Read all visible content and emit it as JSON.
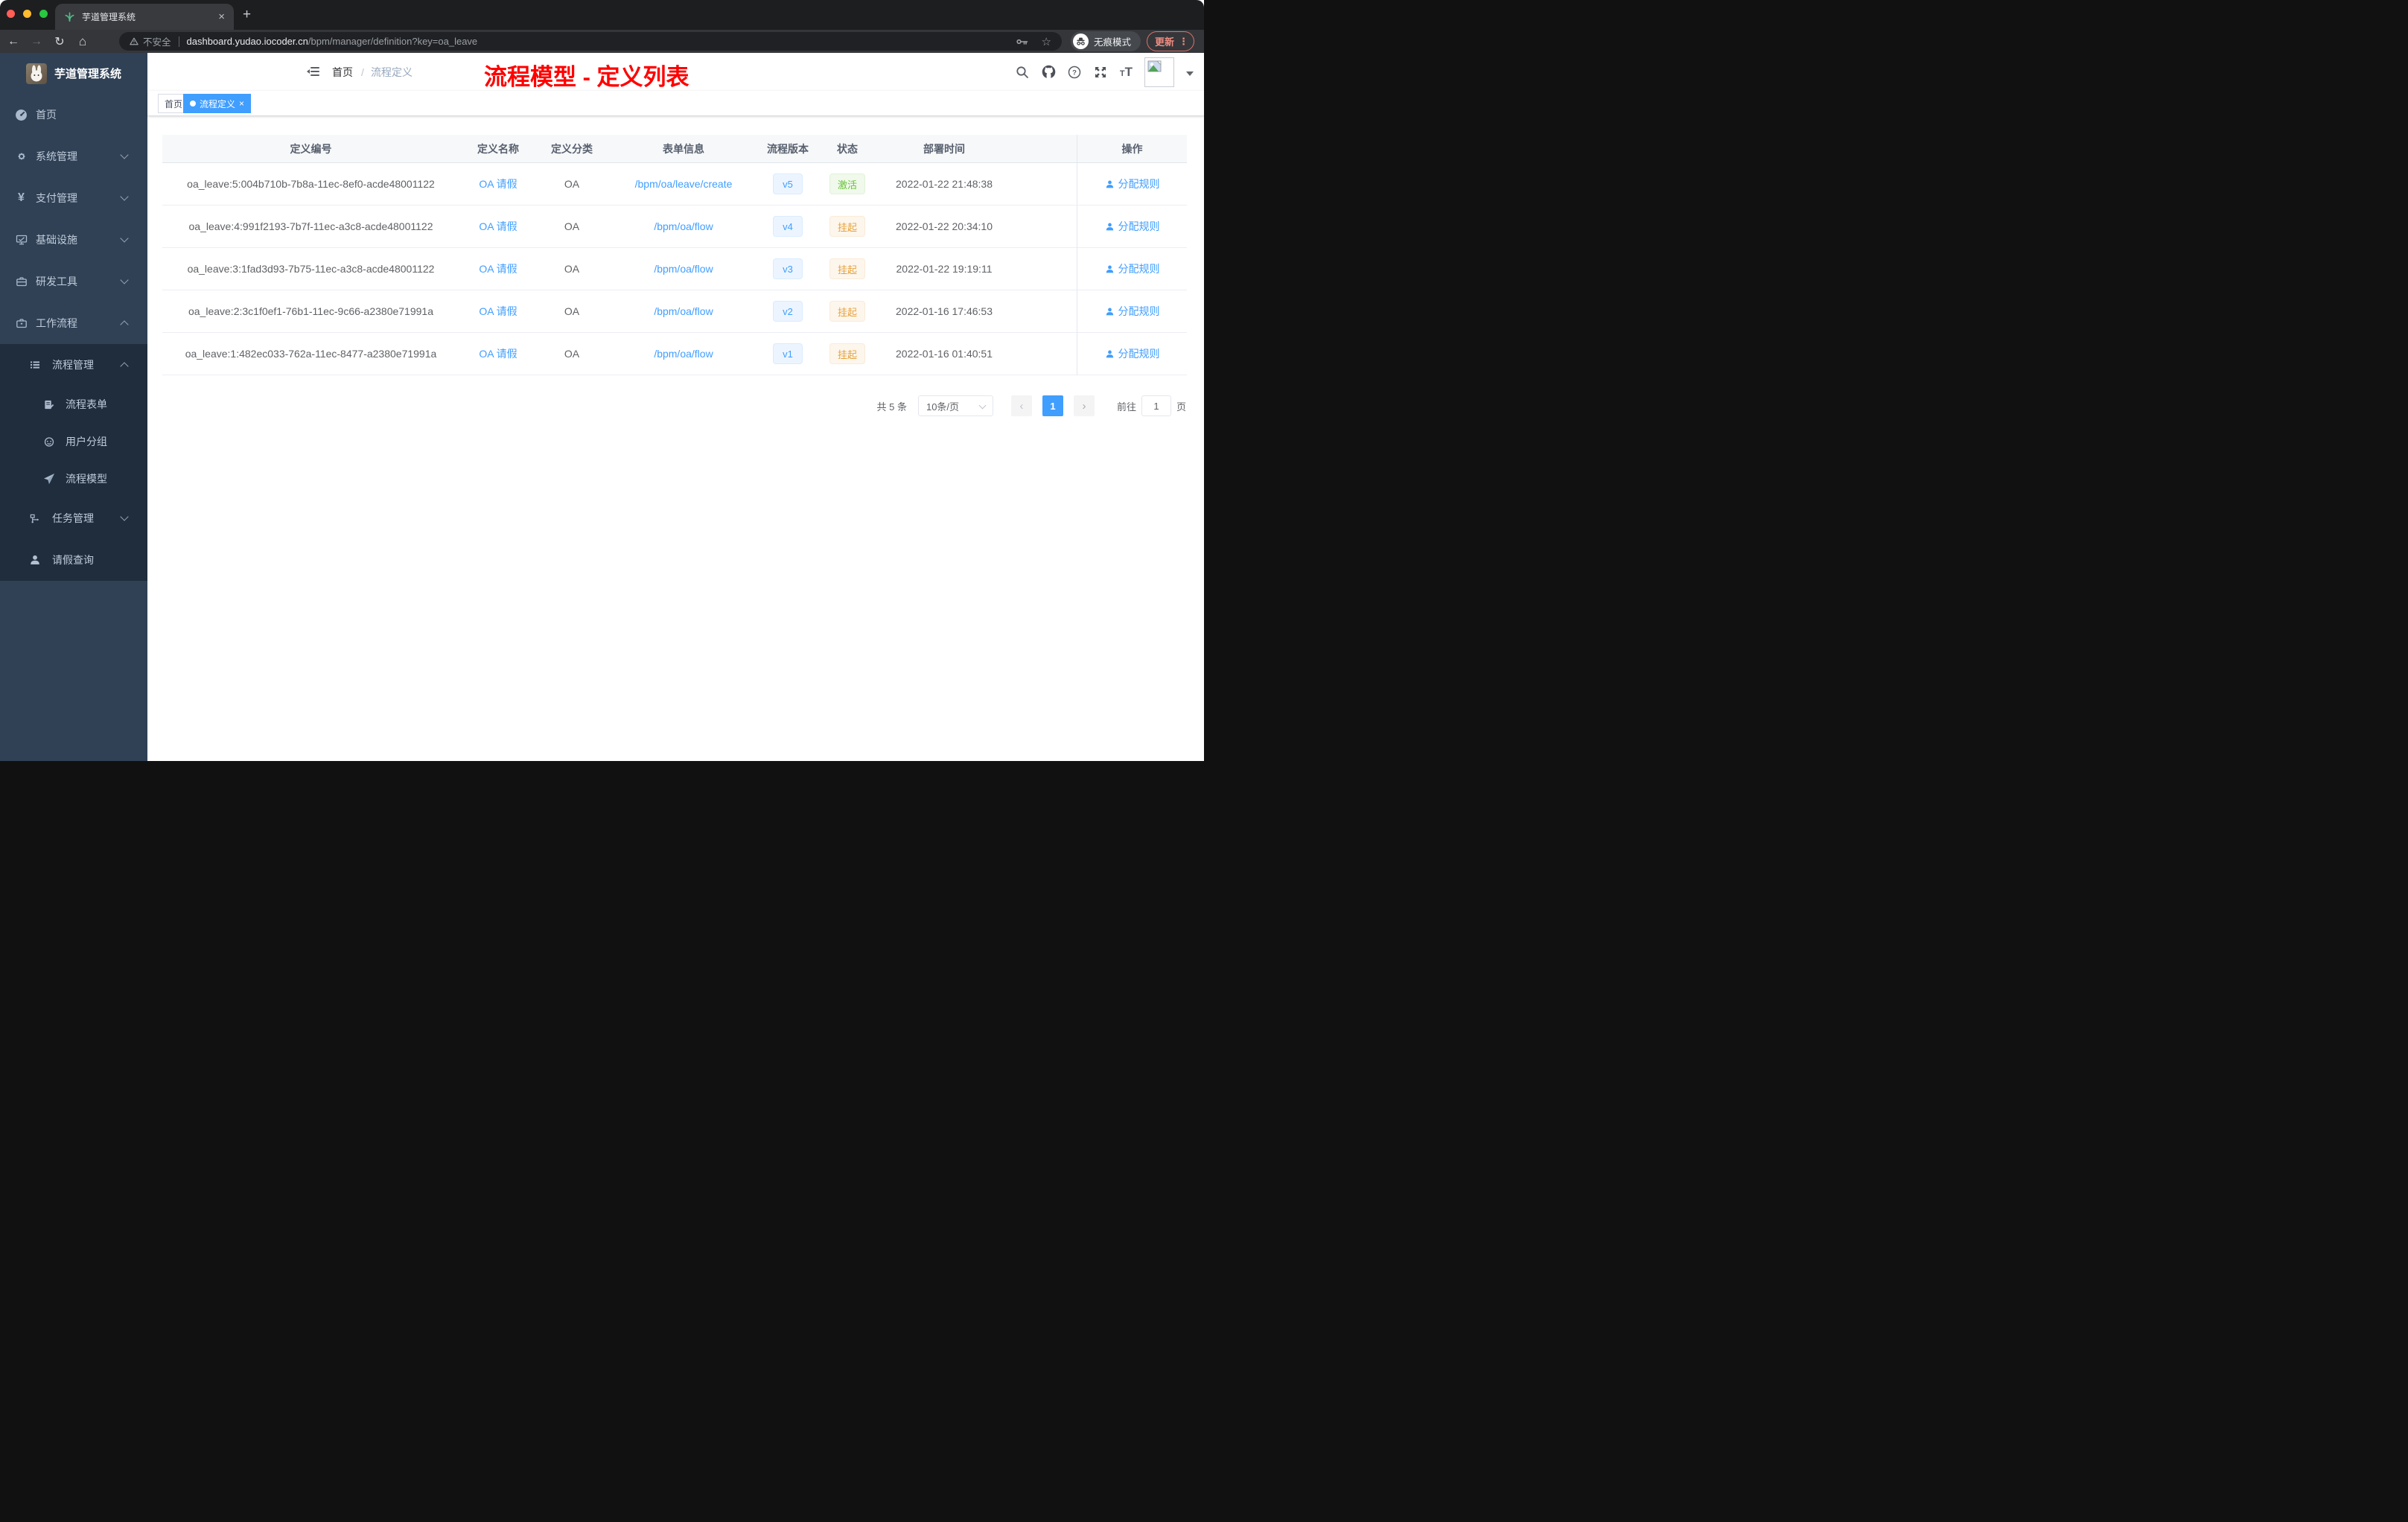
{
  "browser": {
    "tab_title": "芋道管理系统",
    "close_tab_glyph": "×",
    "new_tab_glyph": "+",
    "security_label": "不安全",
    "url_host": "dashboard.yudao.iocoder.cn",
    "url_path": "/bpm/manager/definition?key=oa_leave",
    "star_glyph": "☆",
    "incognito_label": "无痕模式",
    "update_label": "更新",
    "menu_dots": "⋮"
  },
  "sidebar": {
    "app_title": "芋道管理系统",
    "items": [
      {
        "label": "首页",
        "icon": "dashboard-icon"
      },
      {
        "label": "系统管理",
        "icon": "gear-icon",
        "chevron": "down"
      },
      {
        "label": "支付管理",
        "icon": "yen-icon",
        "chevron": "down"
      },
      {
        "label": "基础设施",
        "icon": "monitor-icon",
        "chevron": "down"
      },
      {
        "label": "研发工具",
        "icon": "toolbox-icon",
        "chevron": "down"
      },
      {
        "label": "工作流程",
        "icon": "briefcase-icon",
        "chevron": "up"
      }
    ],
    "yen_glyph": "¥",
    "workflow": {
      "process_mgmt": {
        "label": "流程管理",
        "icon": "list-icon",
        "chevron": "up"
      },
      "process_children": [
        {
          "label": "流程表单",
          "icon": "form-icon"
        },
        {
          "label": "用户分组",
          "icon": "user-group-icon"
        },
        {
          "label": "流程模型",
          "icon": "paper-plane-icon"
        }
      ],
      "task_mgmt": {
        "label": "任务管理",
        "icon": "tree-icon",
        "chevron": "down"
      },
      "leave_query": {
        "label": "请假查询",
        "icon": "person-icon"
      }
    }
  },
  "header": {
    "breadcrumb_home": "首页",
    "breadcrumb_sep": "/",
    "breadcrumb_current": "流程定义",
    "annotation": "流程模型 - 定义列表"
  },
  "tags": {
    "home": "首页",
    "active": "流程定义",
    "close_glyph": "×"
  },
  "table": {
    "columns": [
      "定义编号",
      "定义名称",
      "定义分类",
      "表单信息",
      "流程版本",
      "状态",
      "部署时间",
      "操作"
    ],
    "rows": [
      {
        "id": "oa_leave:5:004b710b-7b8a-11ec-8ef0-acde48001122",
        "name": "OA 请假",
        "category": "OA",
        "form": "/bpm/oa/leave/create",
        "version": "v5",
        "status": "激活",
        "status_type": "success",
        "deployed_at": "2022-01-22 21:48:38",
        "action": "分配规则"
      },
      {
        "id": "oa_leave:4:991f2193-7b7f-11ec-a3c8-acde48001122",
        "name": "OA 请假",
        "category": "OA",
        "form": "/bpm/oa/flow",
        "version": "v4",
        "status": "挂起",
        "status_type": "warning",
        "deployed_at": "2022-01-22 20:34:10",
        "action": "分配规则"
      },
      {
        "id": "oa_leave:3:1fad3d93-7b75-11ec-a3c8-acde48001122",
        "name": "OA 请假",
        "category": "OA",
        "form": "/bpm/oa/flow",
        "version": "v3",
        "status": "挂起",
        "status_type": "warning",
        "deployed_at": "2022-01-22 19:19:11",
        "action": "分配规则"
      },
      {
        "id": "oa_leave:2:3c1f0ef1-76b1-11ec-9c66-a2380e71991a",
        "name": "OA 请假",
        "category": "OA",
        "form": "/bpm/oa/flow",
        "version": "v2",
        "status": "挂起",
        "status_type": "warning",
        "deployed_at": "2022-01-16 17:46:53",
        "action": "分配规则"
      },
      {
        "id": "oa_leave:1:482ec033-762a-11ec-8477-a2380e71991a",
        "name": "OA 请假",
        "category": "OA",
        "form": "/bpm/oa/flow",
        "version": "v1",
        "status": "挂起",
        "status_type": "warning",
        "deployed_at": "2022-01-16 01:40:51",
        "action": "分配规则"
      }
    ]
  },
  "pagination": {
    "total": "共 5 条",
    "page_size": "10条/页",
    "prev_glyph": "‹",
    "next_glyph": "›",
    "current_page": "1",
    "goto_label": "前往",
    "goto_value": "1",
    "page_unit": "页"
  },
  "colors": {
    "primary": "#409EFF",
    "success": "#67C23A",
    "warning": "#E6A23C",
    "sidebar_bg": "#304156",
    "submenu_bg": "#1f2d3d",
    "annotation": "#fe0000",
    "tag_active_bg": "#409EFF"
  }
}
